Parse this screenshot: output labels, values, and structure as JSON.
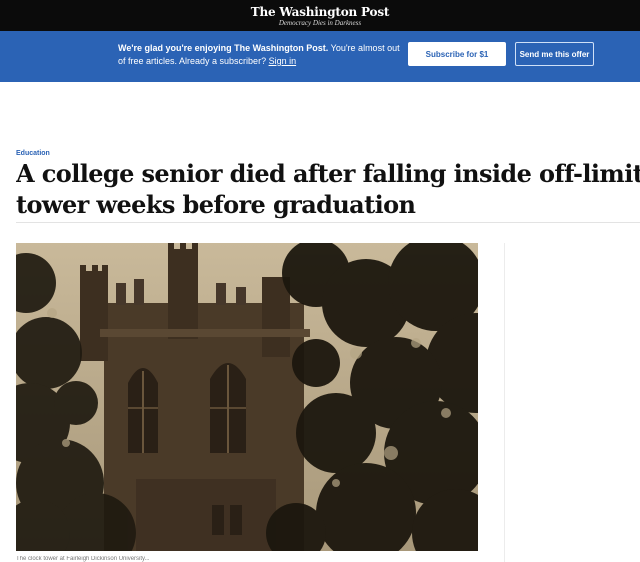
{
  "masthead": {
    "logo": "The Washington Post",
    "tagline": "Democracy Dies in Darkness"
  },
  "banner": {
    "bold_text": "We're glad you're enjoying The Washington Post.",
    "text": " You're almost out of free articles. Already a subscriber? ",
    "signin_label": "Sign in",
    "subscribe_label": "Subscribe for $1",
    "send_offer_label": "Send me this offer",
    "color": "#2b63b5"
  },
  "article": {
    "kicker": "Education",
    "headline_line1": "A college senior died after falling inside off-limits clock",
    "headline_line2": "tower weeks before graduation",
    "photo_caption": "The clock tower at Fairleigh Dickinson University..."
  }
}
